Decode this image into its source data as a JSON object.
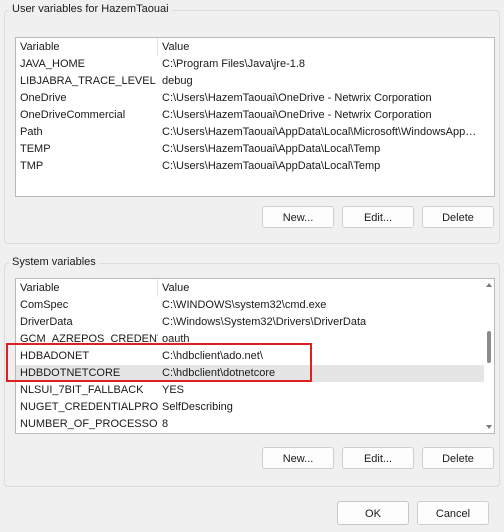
{
  "user_vars": {
    "title": "User variables for HazemTaouai",
    "columns": {
      "variable": "Variable",
      "value": "Value"
    },
    "rows": [
      {
        "variable": "JAVA_HOME",
        "value": "C:\\Program Files\\Java\\jre-1.8"
      },
      {
        "variable": "LIBJABRA_TRACE_LEVEL",
        "value": "debug"
      },
      {
        "variable": "OneDrive",
        "value": "C:\\Users\\HazemTaouai\\OneDrive - Netwrix Corporation"
      },
      {
        "variable": "OneDriveCommercial",
        "value": "C:\\Users\\HazemTaouai\\OneDrive - Netwrix Corporation"
      },
      {
        "variable": "Path",
        "value": "C:\\Users\\HazemTaouai\\AppData\\Local\\Microsoft\\WindowsApps;..."
      },
      {
        "variable": "TEMP",
        "value": "C:\\Users\\HazemTaouai\\AppData\\Local\\Temp"
      },
      {
        "variable": "TMP",
        "value": "C:\\Users\\HazemTaouai\\AppData\\Local\\Temp"
      }
    ],
    "buttons": {
      "new": "New...",
      "edit": "Edit...",
      "delete": "Delete"
    }
  },
  "system_vars": {
    "title": "System variables",
    "columns": {
      "variable": "Variable",
      "value": "Value"
    },
    "rows": [
      {
        "variable": "ComSpec",
        "value": "C:\\WINDOWS\\system32\\cmd.exe"
      },
      {
        "variable": "DriverData",
        "value": "C:\\Windows\\System32\\Drivers\\DriverData"
      },
      {
        "variable": "GCM_AZREPOS_CREDENTI...",
        "value": "oauth"
      },
      {
        "variable": "HDBADONET",
        "value": "C:\\hdbclient\\ado.net\\"
      },
      {
        "variable": "HDBDOTNETCORE",
        "value": "C:\\hdbclient\\dotnetcore"
      },
      {
        "variable": "NLSUI_7BIT_FALLBACK",
        "value": "YES"
      },
      {
        "variable": "NUGET_CREDENTIALPROVI...",
        "value": "SelfDescribing"
      },
      {
        "variable": "NUMBER_OF_PROCESSORS",
        "value": "8"
      }
    ],
    "selected_row": "HDBDOTNETCORE",
    "buttons": {
      "new": "New...",
      "edit": "Edit...",
      "delete": "Delete"
    }
  },
  "dialog_buttons": {
    "ok": "OK",
    "cancel": "Cancel"
  },
  "colors": {
    "highlight": "#e02020",
    "selection": "#e5e5e5"
  }
}
